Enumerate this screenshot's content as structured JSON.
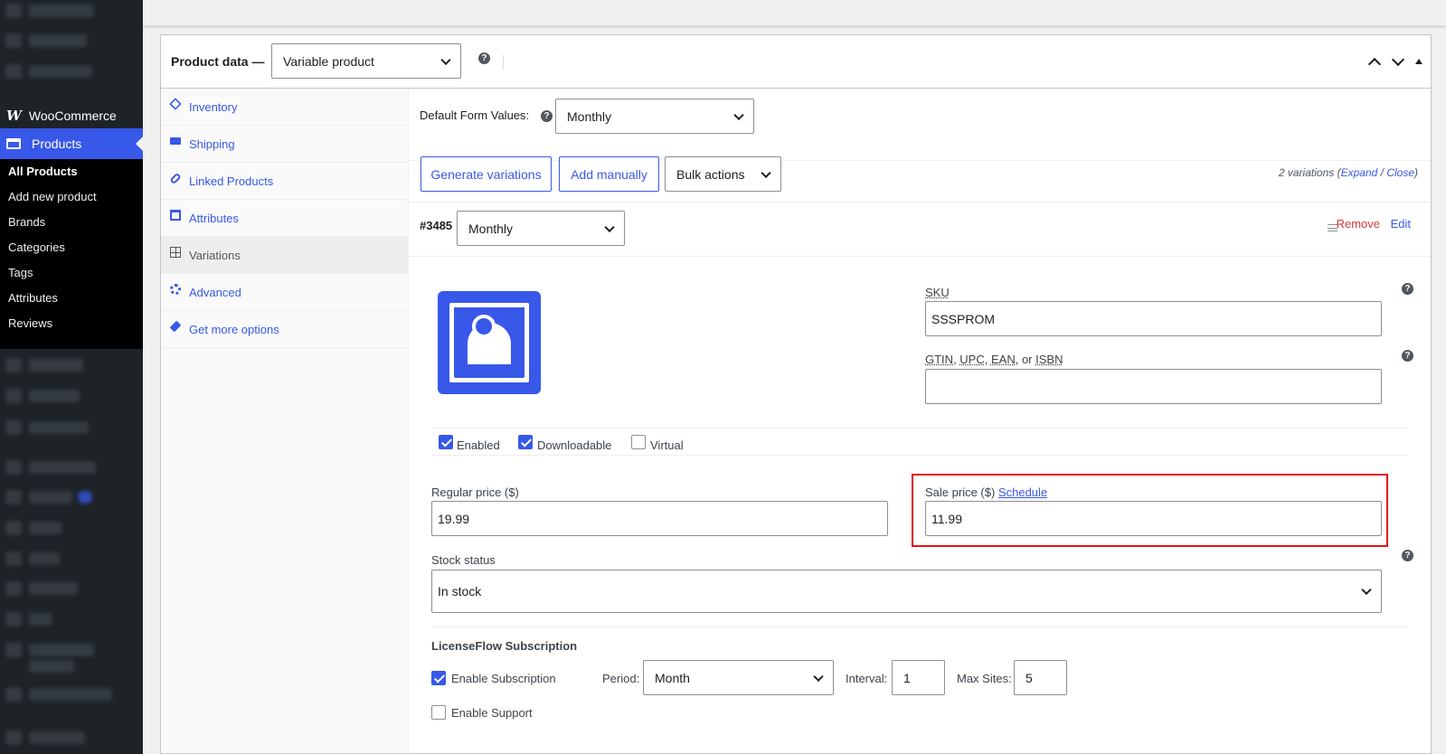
{
  "sidebar": {
    "woocommerce_label": "WooCommerce",
    "woo_logo": "W",
    "products_label": "Products",
    "submenu": [
      "All Products",
      "Add new product",
      "Brands",
      "Categories",
      "Tags",
      "Attributes",
      "Reviews"
    ]
  },
  "product_data": {
    "title": "Product data —",
    "type_value": "Variable product",
    "help": "?"
  },
  "tabs": [
    {
      "label": "Inventory",
      "icon": "tag-icon"
    },
    {
      "label": "Shipping",
      "icon": "truck-icon"
    },
    {
      "label": "Linked Products",
      "icon": "link-icon"
    },
    {
      "label": "Attributes",
      "icon": "list-icon"
    },
    {
      "label": "Variations",
      "icon": "grid-icon"
    },
    {
      "label": "Advanced",
      "icon": "gear-icon"
    },
    {
      "label": "Get more options",
      "icon": "plugin-icon"
    }
  ],
  "defaults": {
    "label": "Default Form Values:",
    "value": "Monthly"
  },
  "actions": {
    "generate": "Generate variations",
    "add_manually": "Add manually",
    "bulk": "Bulk actions",
    "count_text": "2 variations",
    "expand": "Expand",
    "sep": " / ",
    "close": "Close"
  },
  "variation": {
    "id": "#3485",
    "attribute_value": "Monthly",
    "remove": "Remove",
    "edit": "Edit",
    "sku_label": "SKU",
    "sku_value": "SSSPROM",
    "gtin_label_parts": [
      "GTIN",
      ", ",
      "UPC",
      ", ",
      "EAN",
      ", or ",
      "ISBN"
    ],
    "gtin_value": "",
    "enabled": "Enabled",
    "downloadable": "Downloadable",
    "virtual": "Virtual",
    "regular_label": "Regular price ($)",
    "regular_value": "19.99",
    "sale_label": "Sale price ($)",
    "schedule": "Schedule",
    "sale_value": "11.99",
    "stock_label": "Stock status",
    "stock_value": "In stock"
  },
  "license": {
    "title": "LicenseFlow Subscription",
    "enable_sub": "Enable Subscription",
    "period_label": "Period:",
    "period_value": "Month",
    "interval_label": "Interval:",
    "interval_value": "1",
    "max_sites_label": "Max Sites:",
    "max_sites_value": "5",
    "enable_support": "Enable Support"
  },
  "colors": {
    "accent": "#3858e9",
    "remove": "#d63638",
    "highlight": "#e3111b",
    "sidebar": "#1d2327"
  }
}
